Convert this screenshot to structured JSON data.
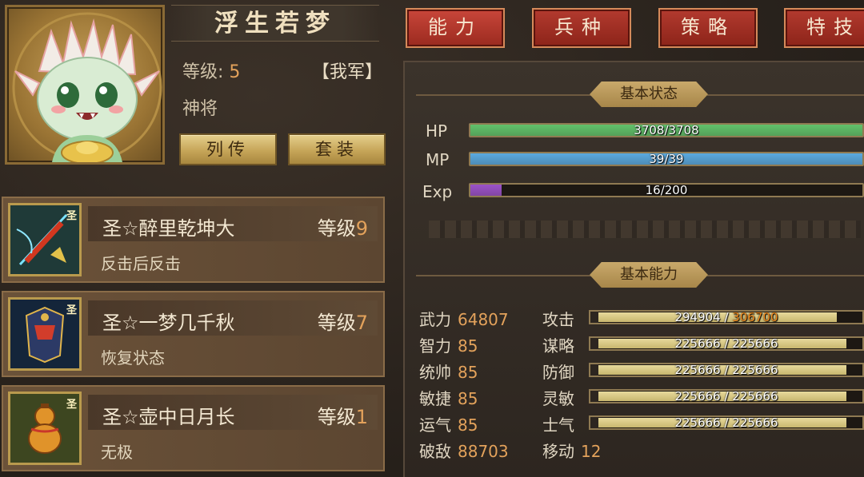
{
  "hero": {
    "name": "浮生若梦",
    "level_label": "等级:",
    "level_value": "5",
    "faction": "【我军】",
    "title": "神将"
  },
  "buttons": {
    "biography": "列传",
    "outfit": "套装"
  },
  "skills": [
    {
      "name": "圣☆醉里乾坤大",
      "level_label": "等级",
      "level": "9",
      "desc": "反击后反击",
      "badge": "圣"
    },
    {
      "name": "圣☆一梦几千秋",
      "level_label": "等级",
      "level": "7",
      "desc": "恢复状态",
      "badge": "圣"
    },
    {
      "name": "圣☆壶中日月长",
      "level_label": "等级",
      "level": "1",
      "desc": "无极",
      "badge": "圣"
    }
  ],
  "tabs": [
    "能力",
    "兵种",
    "策略",
    "特技"
  ],
  "basic_status": {
    "title": "基本状态",
    "hp": {
      "label": "HP",
      "text": "3708/3708",
      "fraction": 1.0,
      "color": "#62c26b"
    },
    "mp": {
      "label": "MP",
      "text": "39/39",
      "fraction": 1.0,
      "color": "#5aa9df"
    },
    "exp": {
      "label": "Exp",
      "text": "16/200",
      "fraction": 0.08,
      "color": "#9b52c8"
    }
  },
  "basic_ability": {
    "title": "基本能力",
    "left_stats": [
      {
        "label": "武力",
        "value": "64807"
      },
      {
        "label": "智力",
        "value": "85"
      },
      {
        "label": "统帅",
        "value": "85"
      },
      {
        "label": "敏捷",
        "value": "85"
      },
      {
        "label": "运气",
        "value": "85"
      },
      {
        "label": "破敌",
        "value": "88703"
      }
    ],
    "right_stats": [
      {
        "label": "攻击",
        "current": "294904",
        "sep": " / ",
        "max": "306700",
        "fraction": 0.96,
        "max_highlight": true
      },
      {
        "label": "谋略",
        "current": "225666",
        "sep": " / ",
        "max": "225666",
        "fraction": 1.0,
        "max_highlight": false
      },
      {
        "label": "防御",
        "current": "225666",
        "sep": " / ",
        "max": "225666",
        "fraction": 1.0,
        "max_highlight": false
      },
      {
        "label": "灵敏",
        "current": "225666",
        "sep": " / ",
        "max": "225666",
        "fraction": 1.0,
        "max_highlight": false
      },
      {
        "label": "士气",
        "current": "225666",
        "sep": " / ",
        "max": "225666",
        "fraction": 1.0,
        "max_highlight": false
      }
    ],
    "move": {
      "label": "移动",
      "value": "12"
    }
  }
}
